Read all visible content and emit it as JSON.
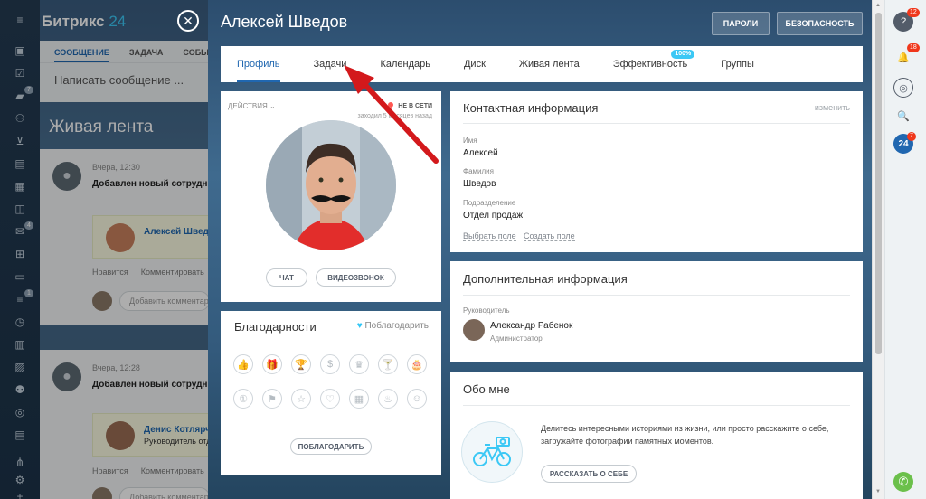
{
  "portal": {
    "logo_main": "Битрикс",
    "logo_num": "24",
    "composer_tabs": [
      "СООБЩЕНИЕ",
      "ЗАДАЧА",
      "СОБЫ"
    ],
    "composer_placeholder": "Написать сообщение ...",
    "feed_title": "Живая лента",
    "posts": [
      {
        "time": "Вчера, 12:30",
        "title": "Добавлен новый сотрудни",
        "name": "Алексей Шведо",
        "role": "",
        "like": "Нравится",
        "comment": "Комментировать",
        "comment_placeholder": "Добавить комментар"
      },
      {
        "time": "Вчера, 12:28",
        "title": "Добавлен новый сотрудни",
        "name": "Денис Котлярч",
        "role": "Руководитель отд",
        "like": "Нравится",
        "comment": "Комментировать",
        "comment_placeholder": "Добавить комментар"
      }
    ]
  },
  "leftbar": {
    "menu_icon": "≡",
    "icons": [
      "chat-icon",
      "tasks-icon",
      "messages-icon",
      "group-icon",
      "cart-icon",
      "crm-icon",
      "calendar-icon",
      "disk-icon",
      "mail-icon",
      "apps-icon",
      "window-icon",
      "filter-icon",
      "clock-icon",
      "chart-icon",
      "contacts-icon",
      "people-icon",
      "money-icon"
    ],
    "badges": {
      "messages": "7",
      "mail": "4",
      "filter": "1"
    },
    "bottom_icons": [
      "share-icon",
      "gear-icon"
    ],
    "add_symbol": "+"
  },
  "close_symbol": "✕",
  "profile": {
    "name": "Алексей Шведов",
    "btn_passwords": "ПАРОЛИ",
    "btn_security": "БЕЗОПАСНОСТЬ",
    "tabs": [
      "Профиль",
      "Задачи",
      "Календарь",
      "Диск",
      "Живая лента",
      "Эффективность",
      "Группы"
    ],
    "efficiency_badge": "100%",
    "actions_label": "ДЕЙСТВИЯ ⌄",
    "status": "НЕ В СЕТИ",
    "last_seen": "заходил 5 месяцев назад",
    "btn_chat": "ЧАТ",
    "btn_video": "ВИДЕОЗВОНОК"
  },
  "thanks": {
    "title": "Благодарности",
    "thank_link": "Поблагодарить",
    "heart": "♥",
    "badge_glyphs": [
      "👍",
      "🎁",
      "🏆",
      "$",
      "♛",
      "🍸",
      "🎂",
      "①",
      "⚑",
      "☆",
      "♡",
      "▦",
      "♨",
      "☺"
    ],
    "button": "ПОБЛАГОДАРИТЬ"
  },
  "contact": {
    "title": "Контактная информация",
    "edit": "изменить",
    "fields": [
      {
        "label": "Имя",
        "value": "Алексей"
      },
      {
        "label": "Фамилия",
        "value": "Шведов"
      },
      {
        "label": "Подразделение",
        "value": "Отдел продаж"
      }
    ],
    "link_choose": "Выбрать поле",
    "link_create": "Создать поле"
  },
  "additional": {
    "title": "Дополнительная информация",
    "manager_label": "Руководитель",
    "manager_name": "Александр Рабенок",
    "manager_role": "Администратор"
  },
  "about": {
    "title": "Обо мне",
    "text": "Делитесь интересными историями из жизни, или просто расскажите о себе, загружайте фотографии памятных моментов.",
    "button": "РАССКАЗАТЬ О СЕБЕ"
  },
  "rightbar": {
    "badges": {
      "help": "12",
      "notifications": "18",
      "b24": "7"
    },
    "b24_label": "24",
    "icons": {
      "help": "?",
      "bell": "🔔",
      "chat": "◎",
      "search": "🔍",
      "phone": "✆"
    }
  },
  "colors": {
    "accent": "#2067b0",
    "cyan": "#3bc8f5",
    "arrow": "#d3191c",
    "offline": "#ff5752",
    "call": "#6bc04b"
  }
}
